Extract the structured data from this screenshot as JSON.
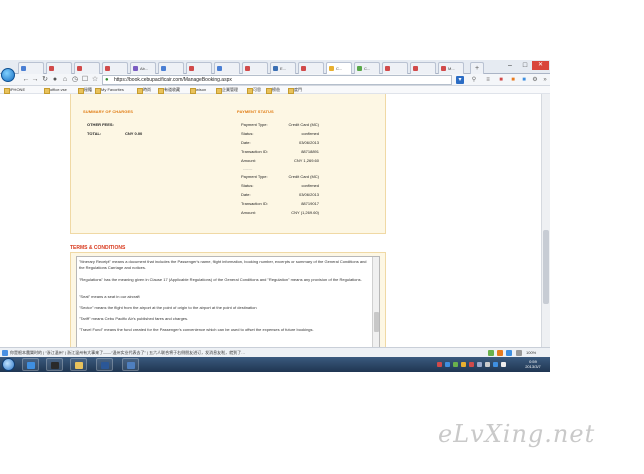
{
  "browser": {
    "tabs": [
      {
        "label": "",
        "color": "#4a7fd4"
      },
      {
        "label": "",
        "color": "#d14a4a"
      },
      {
        "label": "",
        "color": "#d14a4a"
      },
      {
        "label": "",
        "color": "#d14a4a"
      },
      {
        "label": "Ab...",
        "color": "#7a5cc2"
      },
      {
        "label": "",
        "color": "#4a7fd4"
      },
      {
        "label": "",
        "color": "#d14a4a"
      },
      {
        "label": "",
        "color": "#4a7fd4"
      },
      {
        "label": "",
        "color": "#d14a4a"
      },
      {
        "label": "E...",
        "color": "#3b6fb3"
      },
      {
        "label": "",
        "color": "#d14a4a"
      },
      {
        "label": "C...",
        "color": "#e8b030"
      },
      {
        "label": "C...",
        "color": "#5aa84a"
      },
      {
        "label": "",
        "color": "#d14a4a"
      },
      {
        "label": "",
        "color": "#d14a4a"
      },
      {
        "label": "M...",
        "color": "#d14a4a"
      }
    ],
    "active_tab_index": 11,
    "url": "https://book.cebupacificair.com/ManageBooking.aspx",
    "bookmarks": [
      "iPHONE",
      "office.vse",
      "秘籍",
      "My Favorites",
      "時尚",
      "有道收藏",
      "wison",
      "企業管理",
      "可思",
      "螃爸",
      "度門"
    ]
  },
  "summary": {
    "title": "SUMMARY OF CHARGES",
    "other_fees_label": "OTHER FEES:",
    "total_label": "TOTAL:",
    "total_value": "CNY 0.00"
  },
  "payment_status": {
    "title": "PAYMENT STATUS",
    "labels": {
      "type": "Payment Type:",
      "status": "Status:",
      "date": "Date:",
      "transaction": "Transaction ID:",
      "amount": "Amount:"
    },
    "records": [
      {
        "type": "Credit Card (MC)",
        "status": "confirmed",
        "date": "03/06/2013",
        "transaction": "88718891",
        "amount": "CNY 1,269.60"
      },
      {
        "type": "Credit Card (MC)",
        "status": "confirmed",
        "date": "03/06/2013",
        "transaction": "88719017",
        "amount": "CNY (1,269.60)"
      }
    ],
    "divider_text": "-------"
  },
  "terms": {
    "title": "TERMS & CONDITIONS",
    "paragraphs": [
      "\"Itinerary Receipt\" means a document that includes the Passenger's name, flight information, booking number, excerpts or summary of the General Conditions and the Regulations Carriage and notices.",
      "\"Regulations\" has the meaning given in Clause 17 (Applicable Regulations) of the General Conditions and \"Regulation\" means any provision of the Regulations.",
      "\"Seat\" means a seat in our aircraft",
      "\"Sector\" means the flight from the airport at the point of origin to the airport at the point of destination",
      "\"Tariff\" means Cebu Pacific Air's published fares and charges.",
      "\"Travel Fund\" means the fund created for the Passenger's convenience which can be used to offset the expenses of future bookings."
    ]
  },
  "statusbar": {
    "text": "你是根本農樂时的 | “浙江温州” | 浙江温州有大事来了——“温州实业代表去了” | 五六人联合将于右侧朋友进订，发消息友啦，就到了…",
    "zoom": "100%"
  },
  "taskbar": {
    "apps": [
      {
        "name": "ie",
        "color": "#3f8fe0"
      },
      {
        "name": "media",
        "color": "#2a2a2a"
      },
      {
        "name": "explorer",
        "color": "#e9c25c"
      },
      {
        "name": "word",
        "color": "#2b5797"
      },
      {
        "name": "app5",
        "color": "#4e7fbf"
      }
    ],
    "time": "0:59",
    "date": "2013/3/7"
  },
  "watermark": "eLvXing.net"
}
